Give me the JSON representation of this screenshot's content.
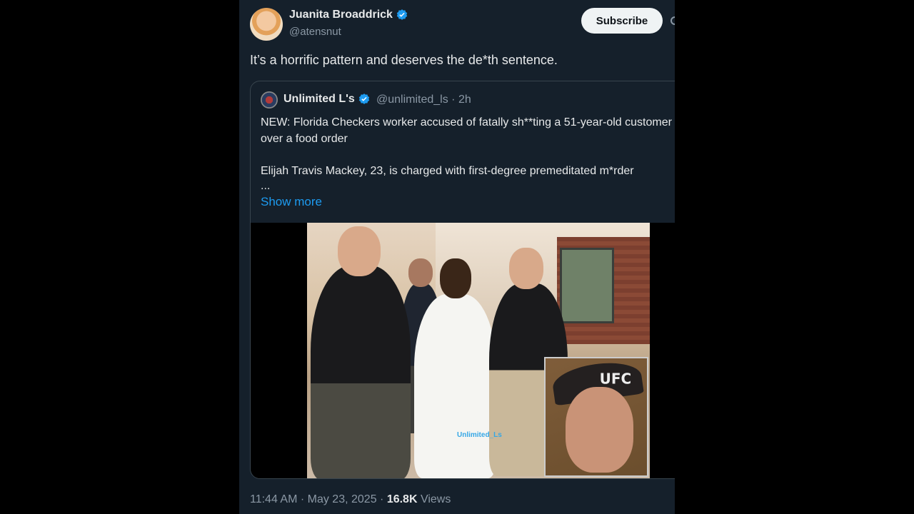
{
  "tweet": {
    "author": {
      "name": "Juanita Broaddrick",
      "handle": "@atensnut",
      "verified": true
    },
    "subscribe_label": "Subscribe",
    "text": "It’s a horrific pattern and deserves the de*th sentence.",
    "timestamp": "11:44 AM · May 23, 2025 ·",
    "views_count": "16.8K",
    "views_label": "Views"
  },
  "quote": {
    "author": {
      "name": "Unlimited L's",
      "handle": "@unlimited_ls",
      "verified": true
    },
    "meta": "@unlimited_ls · 2h",
    "text_line1": "NEW: Florida Checkers worker accused of fatally sh**ting a 51-year-old customer over a food order",
    "text_line2": "Elijah Travis Mackey, 23, is charged with first-degree premeditated m*rder",
    "ellipsis": "...",
    "show_more": "Show more",
    "media": {
      "watermark": "Unlimited_Ls",
      "inset_cap_text": "UFC"
    }
  },
  "colors": {
    "background": "#15202b",
    "accent": "#1d9bf0",
    "verified": "#1d9bf0"
  },
  "icons": [
    "verified-badge-icon",
    "more-icon"
  ]
}
